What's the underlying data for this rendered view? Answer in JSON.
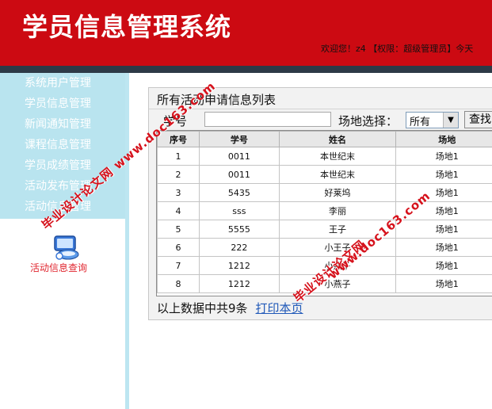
{
  "header": {
    "title": "学员信息管理系统",
    "welcome": "欢迎您！z4 【权限：超级管理员】今天"
  },
  "sidebar": {
    "items": [
      {
        "label": "系统用户管理"
      },
      {
        "label": "学员信息管理"
      },
      {
        "label": "新闻通知管理"
      },
      {
        "label": "课程信息管理"
      },
      {
        "label": "学员成绩管理"
      },
      {
        "label": "活动发布管理"
      },
      {
        "label": "活动信息管理"
      }
    ],
    "app_icon_label": "活动信息查询",
    "app_icon": "computer-network-icon"
  },
  "panel": {
    "title": "所有活动申请信息列表",
    "filter": {
      "id_label": "学号",
      "id_value": "",
      "venue_label": "场地选择：",
      "venue_selected": "所有",
      "search_button": "查找"
    },
    "table": {
      "headers": [
        "序号",
        "学号",
        "姓名",
        "场地"
      ],
      "rows": [
        [
          "1",
          "0011",
          "本世纪末",
          "场地1"
        ],
        [
          "2",
          "0011",
          "本世纪末",
          "场地1"
        ],
        [
          "3",
          "5435",
          "好莱坞",
          "场地1"
        ],
        [
          "4",
          "sss",
          "李丽",
          "场地1"
        ],
        [
          "5",
          "5555",
          "王子",
          "场地1"
        ],
        [
          "6",
          "222",
          "小王子",
          "场地1"
        ],
        [
          "7",
          "1212",
          "小燕子",
          "场地1"
        ],
        [
          "8",
          "1212",
          "小燕子",
          "场地1"
        ]
      ]
    },
    "footer": {
      "summary": "以上数据中共9条",
      "print_link": "打印本页"
    }
  },
  "watermarks": {
    "wm1": "毕业设计论文网 www.doc163.com",
    "wm2": "毕业设计论文网",
    "wm3": "www.doc163.com"
  },
  "colors": {
    "header_red": "#cc0a12",
    "sidebar_blue": "#b9e4ef",
    "link_blue": "#1f58b8",
    "watermark_red": "#d6121c"
  }
}
